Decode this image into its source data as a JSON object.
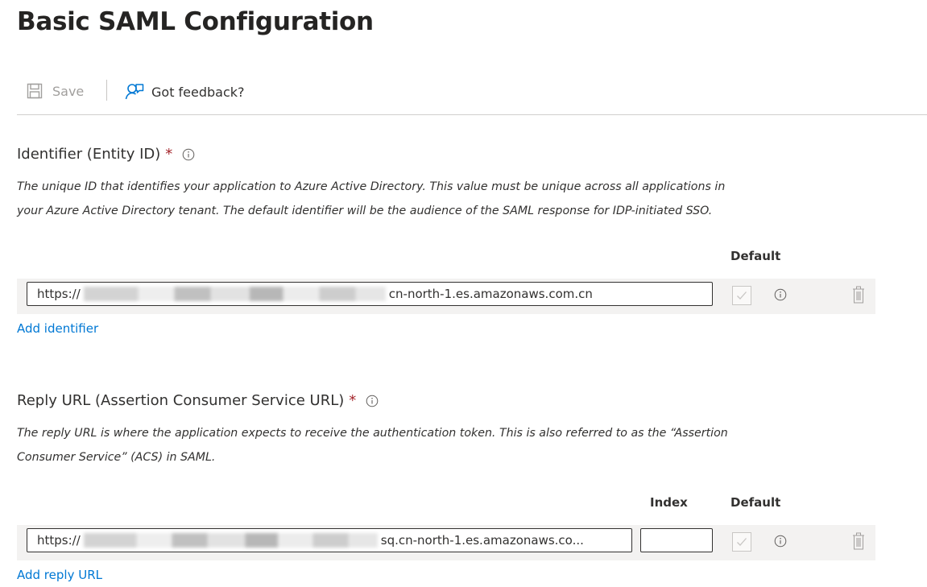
{
  "page": {
    "title": "Basic SAML Configuration"
  },
  "toolbar": {
    "save_label": "Save",
    "feedback_label": "Got feedback?"
  },
  "identifier": {
    "title": "Identifier (Entity ID)",
    "required_mark": "*",
    "description_line1": "The unique ID that identifies your application to Azure Active Directory. This value must be unique across all applications in",
    "description_line2": "your Azure Active Directory tenant. The default identifier will be the audience of the SAML response for IDP-initiated SSO.",
    "default_header": "Default",
    "url_prefix": "https://",
    "url_suffix": "cn-north-1.es.amazonaws.com.cn",
    "add_link": "Add identifier"
  },
  "reply_url": {
    "title": "Reply URL (Assertion Consumer Service URL)",
    "required_mark": "*",
    "description_line1": "The reply URL is where the application expects to receive the authentication token. This is also referred to as the “Assertion",
    "description_line2": "Consumer Service” (ACS) in SAML.",
    "index_header": "Index",
    "default_header": "Default",
    "url_prefix": "https://",
    "url_suffix": "sq.cn-north-1.es.amazonaws.co...",
    "index_value": "",
    "add_link": "Add reply URL"
  },
  "colors": {
    "accent": "#0078d4",
    "required": "#a4262c",
    "row_bg": "#f3f2f1"
  }
}
